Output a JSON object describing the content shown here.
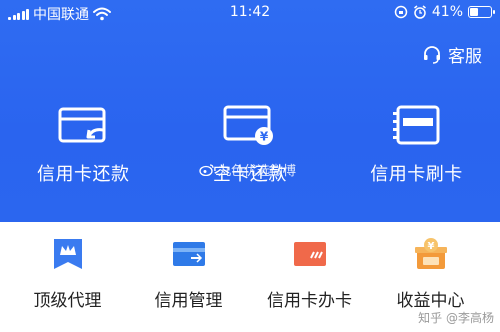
{
  "status_bar": {
    "carrier": "中国联通",
    "time": "11:42",
    "battery_percent": "41%",
    "battery_level": 0.41
  },
  "header": {
    "service_label": "客服"
  },
  "main_actions": [
    {
      "label": "信用卡还款",
      "icon": "card-repay-icon"
    },
    {
      "label": "空卡还款",
      "icon": "card-yen-icon"
    },
    {
      "label": "信用卡刷卡",
      "icon": "card-swipe-icon"
    }
  ],
  "services": [
    {
      "label": "顶级代理",
      "icon": "crown-bookmark-icon",
      "color": "#3a7bf0"
    },
    {
      "label": "信用管理",
      "icon": "card-manage-icon",
      "color": "#2f7ae8"
    },
    {
      "label": "信用卡办卡",
      "icon": "card-apply-icon",
      "color": "#f0694a"
    },
    {
      "label": "收益中心",
      "icon": "gift-yen-icon",
      "color": "#f39a3a"
    }
  ],
  "watermarks": {
    "weibo": "丸色优选微博",
    "zhihu": "知乎 @李高杨"
  },
  "colors": {
    "header_blue": "#2f6cf2",
    "text_dark": "#222222"
  }
}
